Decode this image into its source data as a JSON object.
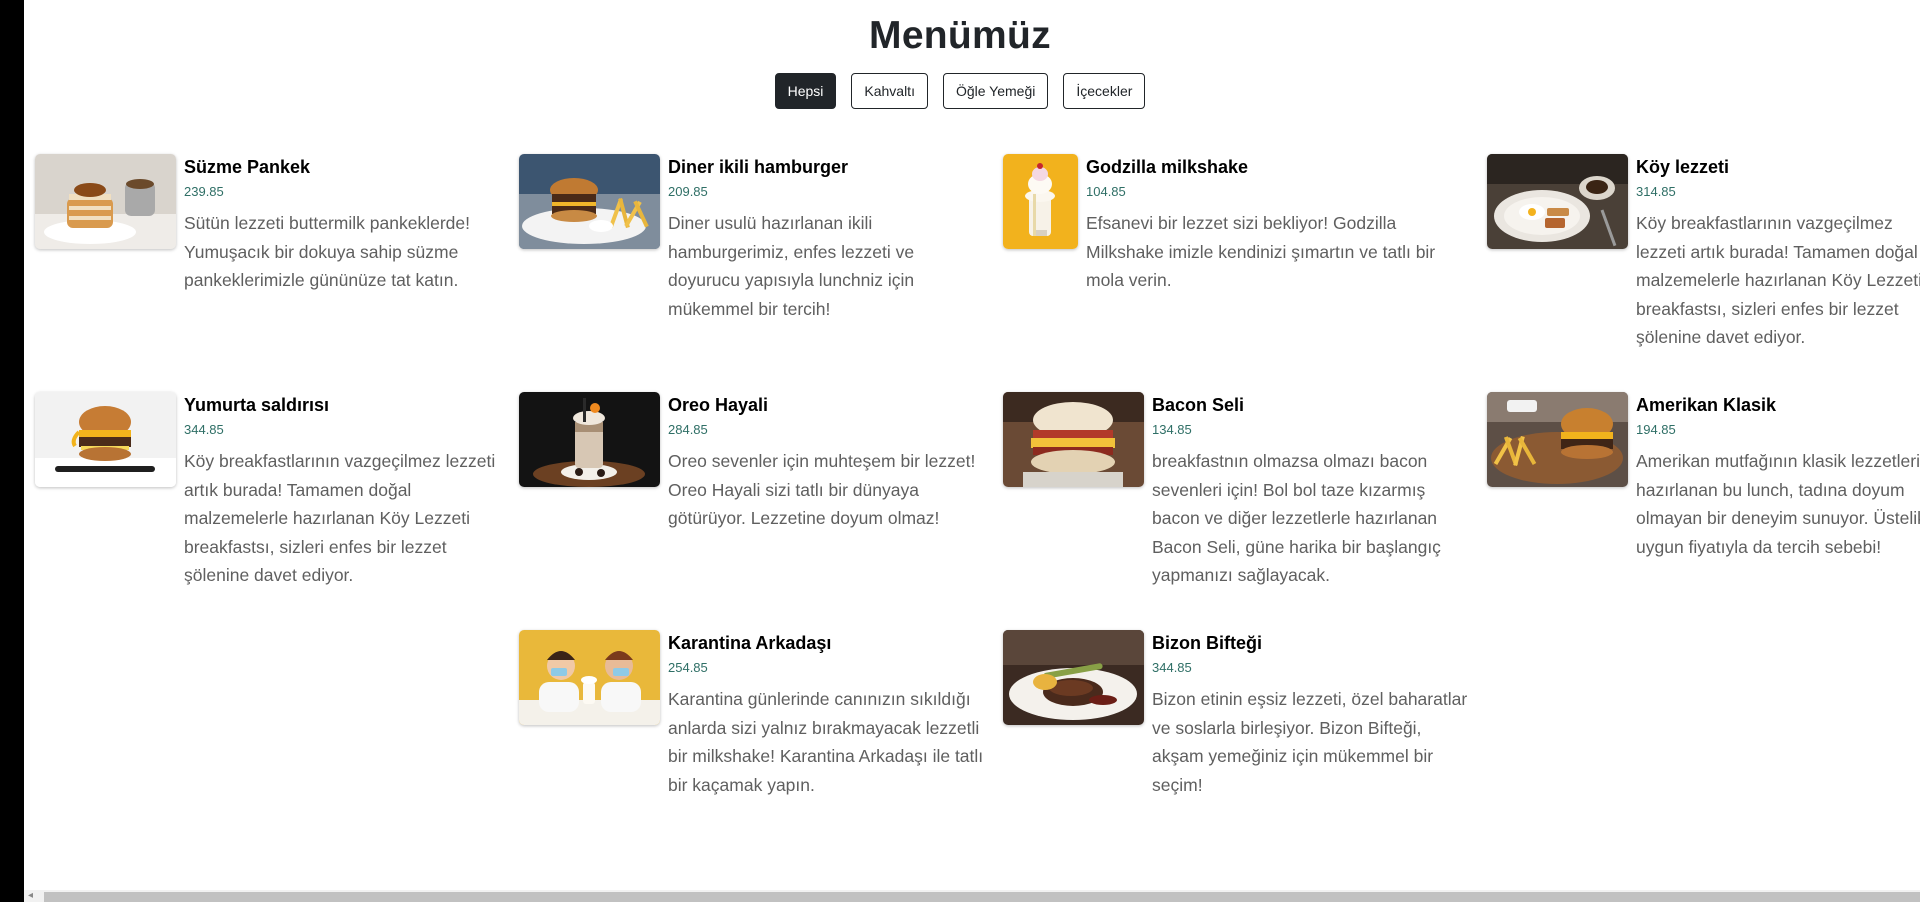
{
  "page": {
    "title": "Menümüz"
  },
  "filters": [
    {
      "label": "Hepsi",
      "active": true
    },
    {
      "label": "Kahvaltı",
      "active": false
    },
    {
      "label": "Öğle Yemeği",
      "active": false
    },
    {
      "label": "İçecekler",
      "active": false
    }
  ],
  "menu": {
    "items": [
      {
        "name": "Süzme Pankek",
        "price": "239.85",
        "desc": "Sütün lezzeti buttermilk pankeklerde! Yumuşacık bir dokuya sahip süzme pankeklerimizle gününüze tat katın.",
        "image": "pancake-stack-image"
      },
      {
        "name": "Diner ikili hamburger",
        "price": "209.85",
        "desc": "Diner usulü hazırlanan ikili hamburgerimiz, enfes lezzeti ve doyurucu yapısıyla lunchniz için mükemmel bir tercih!",
        "image": "double-burger-with-fries-image"
      },
      {
        "name": "Godzilla milkshake",
        "price": "104.85",
        "desc": "Efsanevi bir lezzet sizi bekliyor! Godzilla Milkshake imizle kendinizi şımartın ve tatlı bir mola verin.",
        "image": "milkshake-on-yellow-image"
      },
      {
        "name": "Köy lezzeti",
        "price": "314.85",
        "desc": "Köy breakfastlarının vazgeçilmez lezzeti artık burada! Tamamen doğal malzemelerle hazırlanan Köy Lezzeti breakfastsı, sizleri enfes bir lezzet şölenine davet ediyor.",
        "image": "breakfast-plate-image"
      },
      {
        "name": "Yumurta saldırısı",
        "price": "344.85",
        "desc": "Köy breakfastlarının vazgeçilmez lezzeti artık burada! Tamamen doğal malzemelerle hazırlanan Köy Lezzeti breakfastsı, sizleri enfes bir lezzet şölenine davet ediyor.",
        "image": "egg-burger-image"
      },
      {
        "name": "Oreo Hayali",
        "price": "284.85",
        "desc": "Oreo sevenler için muhteşem bir lezzet! Oreo Hayali sizi tatlı bir dünyaya götürüyor. Lezzetine doyum olmaz!",
        "image": "oreo-milkshake-image"
      },
      {
        "name": "Bacon Seli",
        "price": "134.85",
        "desc": "breakfastnın olmazsa olmazı bacon sevenleri için! Bol bol taze kızarmış bacon ve diğer lezzetlerle hazırlanan Bacon Seli, güne harika bir başlangıç yapmanızı sağlayacak.",
        "image": "bacon-sandwich-image"
      },
      {
        "name": "Amerikan Klasik",
        "price": "194.85",
        "desc": "Amerikan mutfağının klasik lezzetleriyle hazırlanan bu lunch, tadına doyum olmayan bir deneyim sunuyor. Üstelik uygun fiyatıyla da tercih sebebi!",
        "image": "burger-and-fries-board-image"
      },
      {
        "name": "Karantina Arkadaşı",
        "price": "254.85",
        "desc": "Karantina günlerinde canınızın sıkıldığı anlarda sizi yalnız bırakmayacak lezzetli bir milkshake! Karantina Arkadaşı ile tatlı bir kaçamak yapın.",
        "image": "couple-sharing-milkshake-image"
      },
      {
        "name": "Bizon Bifteği",
        "price": "344.85",
        "desc": "Bizon etinin eşsiz lezzeti, özel baharatlar ve soslarla birleşiyor. Bizon Bifteği, akşam yemeğiniz için mükemmel bir seçim!",
        "image": "bison-steak-plate-image"
      }
    ]
  }
}
